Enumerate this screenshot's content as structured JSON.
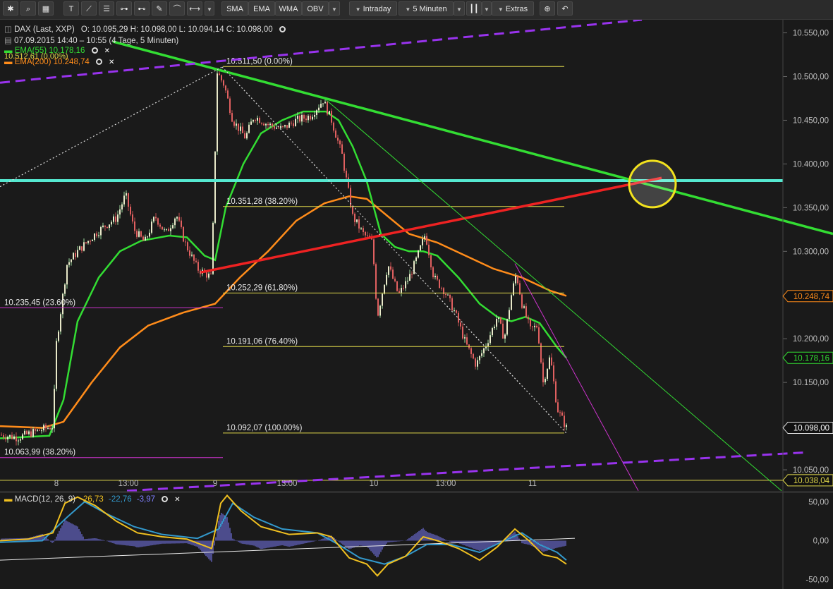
{
  "toolbar": {
    "icons": [
      "gear-icon",
      "search-icon",
      "grid-icon",
      "text-tool-icon",
      "line-tool-icon",
      "fibonacci-icon",
      "hline-icon",
      "channel-icon",
      "brush-icon",
      "arc-icon",
      "measure-icon",
      "chevron-down-icon"
    ],
    "indicator_buttons": [
      "SMA",
      "EMA",
      "WMA",
      "OBV"
    ],
    "period": "Intraday",
    "interval": "5 Minuten",
    "extras": "Extras"
  },
  "header": {
    "instrument": "DAX (Last, XXP)",
    "ohlc": "O: 10.095,29  H: 10.098,00  L: 10.094,14  C: 10.098,00",
    "range": "07.09.2015 14:40 – 10:55 (4 Tage, 5 Minuten)",
    "overlap_label": "10.512,61 (0.00%)",
    "ema55": "EMA(55)  10.178,16",
    "ema200": "EMA(200)  10.248,74"
  },
  "macd_legend": {
    "name": "MACD(12, 26, 9)",
    "v1": "-26,73",
    "v2": "-22,76",
    "v3": "-3,97"
  },
  "colors": {
    "background": "#1a1a1a",
    "ema55": "#33dd33",
    "ema200": "#ff8c1a",
    "fib_line": "#e0d84a",
    "fib_line_magenta": "#cc33cc",
    "support_cyan": "#55e8d0",
    "trend_green": "#33dd33",
    "trend_red": "#ee2222",
    "channel_purple": "#9933ee",
    "highlight_circle": "#f2e21e",
    "macd_line": "#f0c020",
    "signal_line": "#3399cc",
    "histogram": "#7f7fff"
  },
  "chart_data": {
    "type": "candlestick",
    "title": "DAX (Last, XXP)",
    "interval": "5 Minuten",
    "ylim": [
      10025,
      10565
    ],
    "price_ticks": [
      "10.550,00",
      "10.500,00",
      "10.450,00",
      "10.400,00",
      "10.350,00",
      "10.300,00",
      "10.250,00",
      "10.200,00",
      "10.150,00",
      "10.100,00",
      "10.050,00"
    ],
    "x_ticks": [
      "8",
      "13:00",
      "9",
      "13:00",
      "10",
      "13:00",
      "11"
    ],
    "price_tags": [
      {
        "label": "10.248,74",
        "value": 10248.74,
        "color": "#ff8c1a"
      },
      {
        "label": "10.178,16",
        "value": 10178.16,
        "color": "#33dd33"
      },
      {
        "label": "10.098,00",
        "value": 10098,
        "color": "#dddddd"
      },
      {
        "label": "10.038,04",
        "value": 10038.04,
        "color": "#e0d84a"
      }
    ],
    "fib_levels": [
      {
        "label": "10.511,50 (0.00%)",
        "value": 10511.5,
        "color": "#e0d84a"
      },
      {
        "label": "10.351,28 (38.20%)",
        "value": 10351.28,
        "color": "#e0d84a"
      },
      {
        "label": "10.252,29 (61.80%)",
        "value": 10252.29,
        "color": "#e0d84a"
      },
      {
        "label": "10.191,06 (76.40%)",
        "value": 10191.06,
        "color": "#e0d84a"
      },
      {
        "label": "10.092,07 (100.00%)",
        "value": 10092.07,
        "color": "#e0d84a"
      }
    ],
    "fib_levels_prior": [
      {
        "label": "10.235,45 (23.60%)",
        "value": 10235.45
      },
      {
        "label": "10.063,99 (38.20%)",
        "value": 10063.99
      }
    ],
    "horizontal_levels": [
      {
        "name": "support",
        "value": 10381,
        "color": "#55e8d0"
      },
      {
        "name": "lower",
        "value": 10038.04,
        "color": "#e0d84a"
      }
    ],
    "price_path": [
      [
        0,
        10090
      ],
      [
        25,
        10087
      ],
      [
        55,
        10095
      ],
      [
        75,
        10100
      ],
      [
        80,
        10195
      ],
      [
        95,
        10285
      ],
      [
        110,
        10300
      ],
      [
        135,
        10320
      ],
      [
        150,
        10330
      ],
      [
        165,
        10338
      ],
      [
        178,
        10365
      ],
      [
        190,
        10325
      ],
      [
        205,
        10310
      ],
      [
        220,
        10340
      ],
      [
        235,
        10320
      ],
      [
        250,
        10342
      ],
      [
        262,
        10310
      ],
      [
        280,
        10280
      ],
      [
        300,
        10270
      ],
      [
        308,
        10505
      ],
      [
        318,
        10490
      ],
      [
        330,
        10450
      ],
      [
        348,
        10430
      ],
      [
        360,
        10455
      ],
      [
        380,
        10445
      ],
      [
        400,
        10440
      ],
      [
        420,
        10450
      ],
      [
        440,
        10455
      ],
      [
        458,
        10473
      ],
      [
        470,
        10450
      ],
      [
        485,
        10410
      ],
      [
        500,
        10340
      ],
      [
        515,
        10320
      ],
      [
        528,
        10310
      ],
      [
        535,
        10225
      ],
      [
        550,
        10285
      ],
      [
        565,
        10250
      ],
      [
        580,
        10270
      ],
      [
        590,
        10290
      ],
      [
        603,
        10320
      ],
      [
        615,
        10270
      ],
      [
        630,
        10255
      ],
      [
        645,
        10230
      ],
      [
        660,
        10195
      ],
      [
        675,
        10170
      ],
      [
        690,
        10195
      ],
      [
        705,
        10225
      ],
      [
        715,
        10200
      ],
      [
        725,
        10250
      ],
      [
        732,
        10275
      ],
      [
        740,
        10240
      ],
      [
        752,
        10210
      ],
      [
        762,
        10215
      ],
      [
        770,
        10150
      ],
      [
        780,
        10180
      ],
      [
        790,
        10120
      ],
      [
        803,
        10098
      ]
    ],
    "ema55_path": [
      [
        0,
        10086
      ],
      [
        70,
        10089
      ],
      [
        90,
        10130
      ],
      [
        110,
        10220
      ],
      [
        140,
        10270
      ],
      [
        170,
        10300
      ],
      [
        200,
        10312
      ],
      [
        240,
        10318
      ],
      [
        265,
        10316
      ],
      [
        290,
        10295
      ],
      [
        305,
        10290
      ],
      [
        320,
        10350
      ],
      [
        345,
        10400
      ],
      [
        370,
        10435
      ],
      [
        400,
        10450
      ],
      [
        430,
        10460
      ],
      [
        462,
        10460
      ],
      [
        480,
        10450
      ],
      [
        500,
        10420
      ],
      [
        520,
        10380
      ],
      [
        540,
        10320
      ],
      [
        560,
        10305
      ],
      [
        580,
        10300
      ],
      [
        600,
        10300
      ],
      [
        620,
        10295
      ],
      [
        650,
        10270
      ],
      [
        680,
        10240
      ],
      [
        705,
        10225
      ],
      [
        725,
        10220
      ],
      [
        745,
        10225
      ],
      [
        765,
        10218
      ],
      [
        790,
        10190
      ],
      [
        803,
        10178
      ]
    ],
    "ema200_path": [
      [
        0,
        10100
      ],
      [
        60,
        10098
      ],
      [
        90,
        10105
      ],
      [
        130,
        10150
      ],
      [
        170,
        10190
      ],
      [
        210,
        10215
      ],
      [
        260,
        10230
      ],
      [
        305,
        10240
      ],
      [
        340,
        10270
      ],
      [
        380,
        10300
      ],
      [
        420,
        10335
      ],
      [
        460,
        10355
      ],
      [
        495,
        10363
      ],
      [
        520,
        10360
      ],
      [
        550,
        10340
      ],
      [
        580,
        10320
      ],
      [
        620,
        10310
      ],
      [
        660,
        10295
      ],
      [
        700,
        10280
      ],
      [
        740,
        10270
      ],
      [
        780,
        10255
      ],
      [
        803,
        10249
      ]
    ],
    "trendlines": [
      {
        "name": "green-downtrend",
        "from": [
          160,
          10540
        ],
        "to": [
          1181,
          10320
        ],
        "color": "#33dd33"
      },
      {
        "name": "red-uptrend",
        "from": [
          285,
          10276
        ],
        "to": [
          938,
          10384
        ],
        "color": "#ee2222"
      },
      {
        "name": "fib-anchor-dotted-up",
        "from": [
          0,
          10374
        ],
        "to": [
          315,
          10511
        ],
        "color": "#dddddd"
      },
      {
        "name": "fib-anchor-dotted-down",
        "from": [
          315,
          10511
        ],
        "to": [
          803,
          10092
        ],
        "color": "#dddddd"
      },
      {
        "name": "thin-green",
        "from": [
          460,
          10475
        ],
        "to": [
          1108,
          10026
        ],
        "color": "#33dd33"
      },
      {
        "name": "thin-magenta",
        "from": [
          730,
          10286
        ],
        "to": [
          905,
          10026
        ],
        "color": "#cc33cc"
      },
      {
        "name": "purple-channel-upper",
        "from": [
          0,
          10493
        ],
        "to": [
          910,
          10565
        ],
        "color": "#9933ee"
      },
      {
        "name": "purple-channel-lower",
        "from": [
          180,
          10026
        ],
        "to": [
          1145,
          10070
        ],
        "color": "#9933ee"
      }
    ],
    "highlight": {
      "name": "intersection-circle",
      "x": 925,
      "value": 10377
    },
    "macd": {
      "ylim": [
        -62,
        62
      ],
      "ticks": [
        "50,00",
        "0,00",
        "-50,00"
      ],
      "macd_path": [
        [
          0,
          0
        ],
        [
          40,
          2
        ],
        [
          75,
          10
        ],
        [
          92,
          48
        ],
        [
          110,
          56
        ],
        [
          135,
          45
        ],
        [
          165,
          25
        ],
        [
          195,
          10
        ],
        [
          230,
          5
        ],
        [
          265,
          2
        ],
        [
          300,
          -10
        ],
        [
          313,
          48
        ],
        [
          322,
          58
        ],
        [
          342,
          38
        ],
        [
          370,
          18
        ],
        [
          410,
          8
        ],
        [
          450,
          10
        ],
        [
          470,
          5
        ],
        [
          495,
          -22
        ],
        [
          520,
          -30
        ],
        [
          535,
          -45
        ],
        [
          550,
          -30
        ],
        [
          575,
          -20
        ],
        [
          600,
          5
        ],
        [
          620,
          0
        ],
        [
          650,
          -10
        ],
        [
          680,
          -25
        ],
        [
          705,
          -8
        ],
        [
          730,
          15
        ],
        [
          750,
          0
        ],
        [
          770,
          -18
        ],
        [
          790,
          -22
        ],
        [
          803,
          -30
        ]
      ],
      "signal_path": [
        [
          0,
          -2
        ],
        [
          60,
          0
        ],
        [
          95,
          30
        ],
        [
          120,
          50
        ],
        [
          150,
          35
        ],
        [
          190,
          18
        ],
        [
          230,
          8
        ],
        [
          280,
          3
        ],
        [
          310,
          15
        ],
        [
          330,
          48
        ],
        [
          360,
          30
        ],
        [
          400,
          15
        ],
        [
          450,
          10
        ],
        [
          480,
          -5
        ],
        [
          510,
          -22
        ],
        [
          545,
          -30
        ],
        [
          575,
          -20
        ],
        [
          605,
          -5
        ],
        [
          640,
          -5
        ],
        [
          680,
          -15
        ],
        [
          715,
          0
        ],
        [
          740,
          10
        ],
        [
          765,
          -5
        ],
        [
          790,
          -15
        ],
        [
          803,
          -25
        ]
      ],
      "white_line": [
        [
          0,
          -25
        ],
        [
          815,
          3
        ]
      ]
    }
  }
}
